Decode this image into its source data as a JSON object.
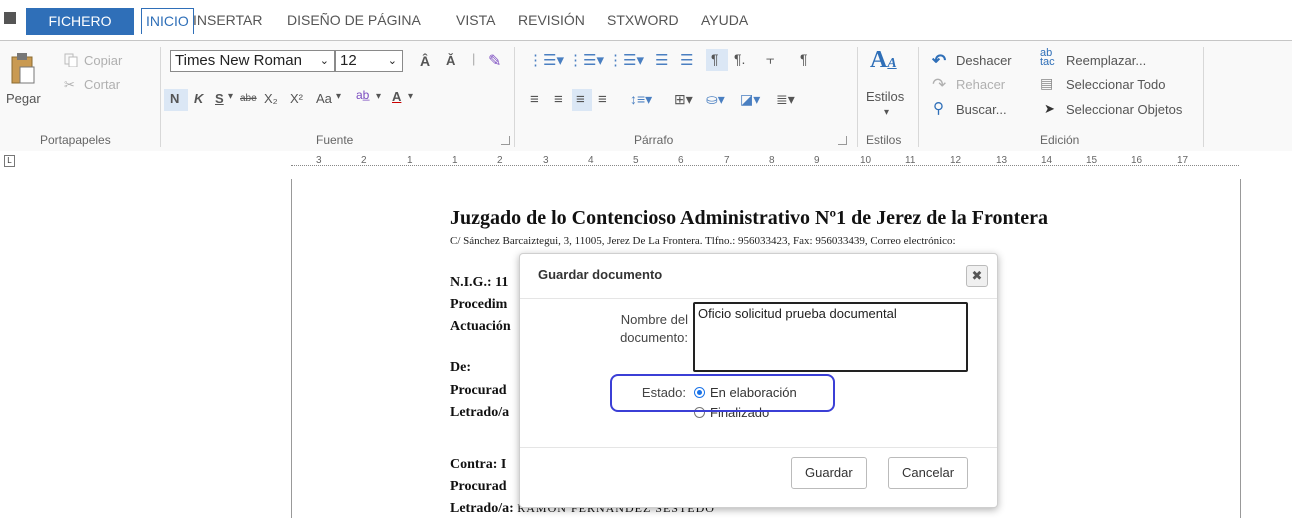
{
  "tabs": [
    "FICHERO",
    "INICIO",
    "INSERTAR",
    "DISEÑO DE PÁGINA",
    "VISTA",
    "REVISIÓN",
    "STXWORD",
    "AYUDA"
  ],
  "portapapeles": {
    "paste": "Pegar",
    "copy": "Copiar",
    "cut": "Cortar",
    "group": "Portapapeles"
  },
  "fuente": {
    "font": "Times New Roman",
    "size": "12",
    "bold": "N",
    "italic": "K",
    "underline": "S",
    "strike": "abe",
    "sub": "X₂",
    "sup": "X²",
    "case": "Aa",
    "group": "Fuente"
  },
  "parrafo": {
    "group": "Párrafo"
  },
  "estilos": {
    "label": "Estilos",
    "group": "Estilos"
  },
  "edicion": {
    "undo": "Deshacer",
    "redo": "Rehacer",
    "find": "Buscar...",
    "replace": "Reemplazar...",
    "select_all": "Seleccionar Todo",
    "select_objects": "Seleccionar Objetos",
    "group": "Edición"
  },
  "ruler": {
    "numbers": [
      "3",
      "2",
      "1",
      "1",
      "2",
      "3",
      "4",
      "5",
      "6",
      "7",
      "8",
      "9",
      "10",
      "11",
      "12",
      "13",
      "14",
      "15",
      "16",
      "17"
    ]
  },
  "document": {
    "title": "Juzgado de lo Contencioso Administrativo Nº1 de Jerez de la Frontera",
    "address": "C/ Sánchez Barcaiztegui, 3, 11005, Jerez De La Frontera. Tlfno.: 956033423, Fax: 956033439, Correo electrónico:",
    "nig": "N.I.G.: 11",
    "procedimiento": "Procedim",
    "actuacion": "Actuación",
    "de": "De:",
    "procurador1": "Procurad",
    "letrado1": "Letrado/a",
    "contra": "Contra: I",
    "procurador2": "Procurad",
    "letrado2": "Letrado/a:",
    "letrado2_name": "RAMON FERNANDEZ SESTEDO"
  },
  "dialog": {
    "title": "Guardar documento",
    "close": "✖",
    "name_label": "Nombre del documento:",
    "name_value": "Oficio solicitud prueba documental",
    "estado_label": "Estado:",
    "option1": "En elaboración",
    "option2": "Finalizado",
    "save": "Guardar",
    "cancel": "Cancelar"
  },
  "colors": {
    "accent": "#2f6fb8",
    "highlight": "#3b3fd6",
    "radio": "#1a73e8"
  }
}
